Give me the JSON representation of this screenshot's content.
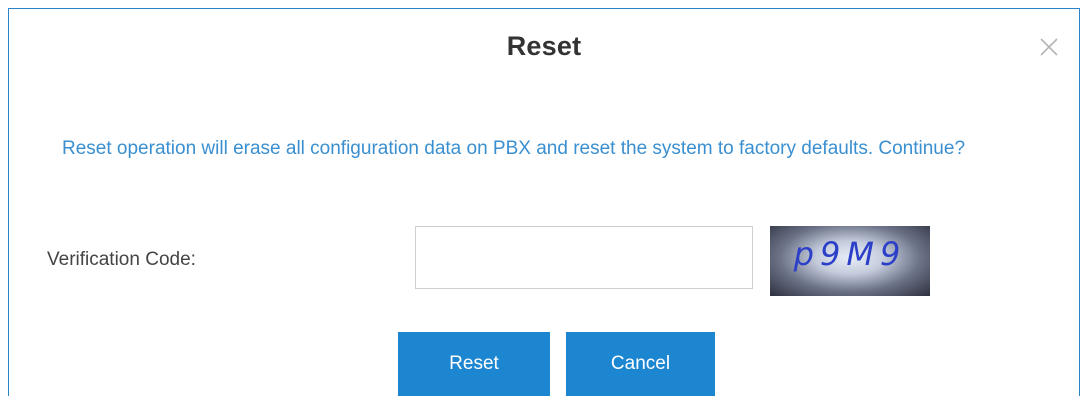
{
  "dialog": {
    "title": "Reset",
    "message": "Reset operation will erase all configuration data on PBX and reset the system to factory defaults. Continue?",
    "verification_label": "Verification Code:",
    "verification_value": "",
    "captcha_text": "p9M9",
    "reset_label": "Reset",
    "cancel_label": "Cancel",
    "close_icon": "close-icon"
  },
  "colors": {
    "accent": "#1d86d1",
    "message_text": "#3a8fd0",
    "border": "#2a84c7",
    "captcha_text": "#2b3fc8"
  }
}
